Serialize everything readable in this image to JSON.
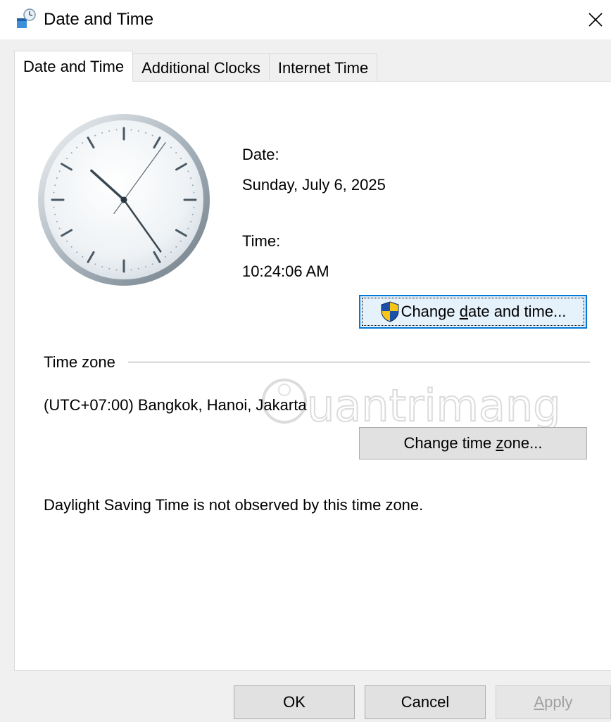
{
  "window": {
    "title": "Date and Time",
    "icon": "date-time-control-panel-icon",
    "close_icon": "close-icon"
  },
  "tabs": [
    {
      "label": "Date and Time",
      "active": true
    },
    {
      "label": "Additional Clocks",
      "active": false
    },
    {
      "label": "Internet Time",
      "active": false
    }
  ],
  "clock": {
    "hour": 10,
    "minute": 24,
    "second": 6
  },
  "date": {
    "label": "Date:",
    "value": "Sunday, July 6, 2025"
  },
  "time": {
    "label": "Time:",
    "value": "10:24:06 AM"
  },
  "buttons": {
    "change_date_time": {
      "before": "Change ",
      "accel": "d",
      "after": "ate and time...",
      "icon": "uac-shield-icon"
    },
    "change_time_zone": {
      "before": "Change time ",
      "accel": "z",
      "after": "one..."
    },
    "ok": "OK",
    "cancel": "Cancel",
    "apply": {
      "before": "",
      "accel": "A",
      "after": "pply",
      "disabled": true
    }
  },
  "timezone": {
    "section_label": "Time zone",
    "value": "(UTC+07:00) Bangkok, Hanoi, Jakarta",
    "dst_note": "Daylight Saving Time is not observed by this time zone."
  },
  "watermark": {
    "text": "uantrimang"
  },
  "colors": {
    "focus_border": "#0078d7",
    "button_face": "#e1e1e1",
    "dialog_bg": "#f0f0f0"
  }
}
